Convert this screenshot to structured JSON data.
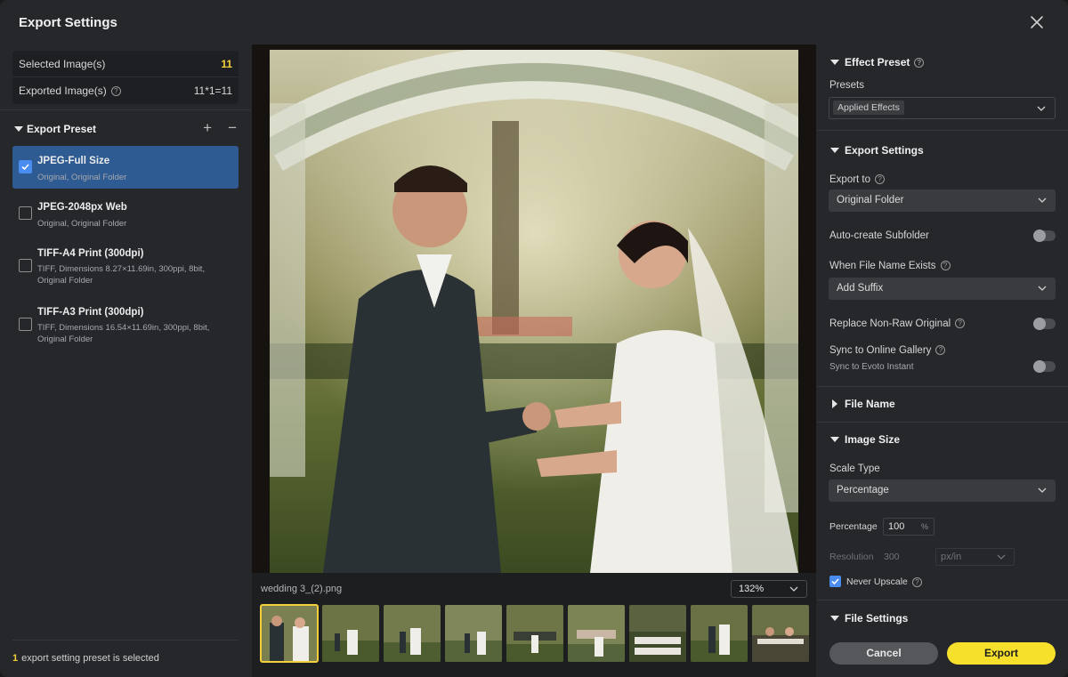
{
  "dialog": {
    "title": "Export Settings"
  },
  "left": {
    "selected_label": "Selected Image(s)",
    "selected_value": "11",
    "exported_label": "Exported Image(s)",
    "exported_value": "11*1=11",
    "preset_section": "Export Preset",
    "add_symbol": "+",
    "remove_symbol": "−",
    "presets": [
      {
        "name": "JPEG-Full Size",
        "desc": "Original, Original Folder",
        "checked": true
      },
      {
        "name": "JPEG-2048px Web",
        "desc": "Original, Original Folder",
        "checked": false
      },
      {
        "name": "TIFF-A4 Print (300dpi)",
        "desc": "TIFF, Dimensions 8.27×11.69in, 300ppi, 8bit, Original Folder",
        "checked": false
      },
      {
        "name": "TIFF-A3 Print (300dpi)",
        "desc": "TIFF, Dimensions 16.54×11.69in, 300ppi, 8bit, Original Folder",
        "checked": false
      }
    ],
    "footer_count": "1",
    "footer_text": "export setting preset is selected"
  },
  "center": {
    "filename": "wedding 3_(2).png",
    "zoom": "132%"
  },
  "right": {
    "effect_preset": "Effect Preset",
    "presets_label": "Presets",
    "presets_value": "Applied Effects",
    "export_settings": "Export Settings",
    "export_to_label": "Export to",
    "export_to_value": "Original Folder",
    "auto_subfolder": "Auto-create Subfolder",
    "when_exists_label": "When File Name Exists",
    "when_exists_value": "Add Suffix",
    "replace_nonraw": "Replace Non-Raw Original",
    "sync_gallery": "Sync to Online Gallery",
    "sync_sub": "Sync to Evoto Instant",
    "file_name": "File Name",
    "image_size": "Image Size",
    "scale_type_label": "Scale Type",
    "scale_type_value": "Percentage",
    "percentage_label": "Percentage",
    "percentage_value": "100",
    "percentage_unit": "%",
    "resolution_label": "Resolution",
    "resolution_value": "300",
    "resolution_unit": "px/in",
    "never_upscale": "Never Upscale",
    "file_settings": "File Settings",
    "cancel": "Cancel",
    "export": "Export"
  },
  "colors": {
    "accent": "#f7e02b",
    "selection": "#2f5b93",
    "check": "#4a8cf0",
    "highlight": "#f5cf3b"
  }
}
